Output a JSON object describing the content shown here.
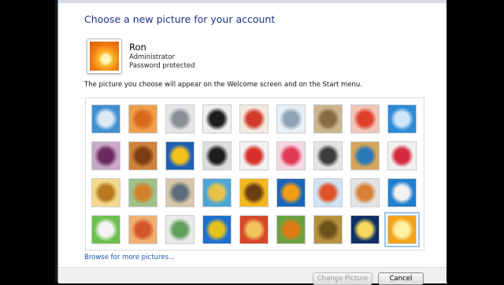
{
  "dialog": {
    "heading": "Choose a new picture for your account",
    "description": "The picture you choose will appear on the Welcome screen and on the Start menu.",
    "browse_link": "Browse for more pictures..."
  },
  "account": {
    "name": "Ron",
    "role": "Administrator",
    "status": "Password protected",
    "picture": "flower-orange"
  },
  "pictures": [
    {
      "name": "rollercoaster",
      "bg": "#3f8fd2",
      "fg": "#dfe9f6"
    },
    {
      "name": "starfish",
      "bg": "#f0a04a",
      "fg": "#d86a1e"
    },
    {
      "name": "robot-white",
      "bg": "#e6e6e6",
      "fg": "#8a8f96"
    },
    {
      "name": "vinyl-record",
      "bg": "#efefef",
      "fg": "#1c1c1c"
    },
    {
      "name": "lucky-cat",
      "bg": "#f3e9e0",
      "fg": "#d23b2a"
    },
    {
      "name": "gyroscope",
      "bg": "#e8f0f6",
      "fg": "#8ea3b6"
    },
    {
      "name": "kitten",
      "bg": "#cbb68f",
      "fg": "#8a6b40"
    },
    {
      "name": "red-flower",
      "bg": "#f0c6b8",
      "fg": "#e0402a"
    },
    {
      "name": "windmill",
      "bg": "#2c8bd8",
      "fg": "#cfe6f8"
    },
    {
      "name": "ball-purple",
      "bg": "#c9a8c8",
      "fg": "#6b2a5e"
    },
    {
      "name": "wood-blocks",
      "bg": "#d1833a",
      "fg": "#7c3d12"
    },
    {
      "name": "yellow-leaf",
      "bg": "#1f5fb5",
      "fg": "#f2c21c"
    },
    {
      "name": "puppy-bw",
      "bg": "#dcdcdc",
      "fg": "#1e1e1e"
    },
    {
      "name": "crayons",
      "bg": "#f2f2f2",
      "fg": "#d9312a"
    },
    {
      "name": "starburst",
      "bg": "#f5d6e4",
      "fg": "#e33a56"
    },
    {
      "name": "jacks",
      "bg": "#e4e4e4",
      "fg": "#3d3d3d"
    },
    {
      "name": "stairs",
      "bg": "#d6a55b",
      "fg": "#2b78b8"
    },
    {
      "name": "origami-crane",
      "bg": "#f1f1f1",
      "fg": "#d42b3e"
    },
    {
      "name": "guitar",
      "bg": "#f3d98e",
      "fg": "#b8781f"
    },
    {
      "name": "pomeranian",
      "bg": "#9ec28a",
      "fg": "#d2822a"
    },
    {
      "name": "robot-toy",
      "bg": "#d8c6a8",
      "fg": "#5f6c7d"
    },
    {
      "name": "fabric",
      "bg": "#4ca6d6",
      "fg": "#e9c24a"
    },
    {
      "name": "sunflower",
      "bg": "#f2b81e",
      "fg": "#6b3f12"
    },
    {
      "name": "fish",
      "bg": "#1a66b9",
      "fg": "#f39c18"
    },
    {
      "name": "balloon",
      "bg": "#cfe3f4",
      "fg": "#e0532a"
    },
    {
      "name": "bird",
      "bg": "#e3e3e3",
      "fg": "#d78036"
    },
    {
      "name": "sailboat",
      "bg": "#1f7fcf",
      "fg": "#f2f2f2"
    },
    {
      "name": "soccer-ball",
      "bg": "#6dbf4e",
      "fg": "#f4f4f4"
    },
    {
      "name": "pencils",
      "bg": "#f0b070",
      "fg": "#d4552a"
    },
    {
      "name": "marbles",
      "bg": "#e9e9e9",
      "fg": "#5f9f5a"
    },
    {
      "name": "window",
      "bg": "#1d6fd0",
      "fg": "#e3c21a"
    },
    {
      "name": "pattern",
      "bg": "#d6472a",
      "fg": "#f2c45c"
    },
    {
      "name": "butterfly",
      "bg": "#6aa13e",
      "fg": "#e07a12"
    },
    {
      "name": "nest",
      "bg": "#b6923e",
      "fg": "#6e511a"
    },
    {
      "name": "lighthouse",
      "bg": "#0f2f64",
      "fg": "#f4d85a"
    },
    {
      "name": "orange-flower",
      "bg": "#f4a21b",
      "fg": "#fff2a5",
      "selected": true
    }
  ],
  "buttons": {
    "change": "Change Picture",
    "cancel": "Cancel"
  }
}
